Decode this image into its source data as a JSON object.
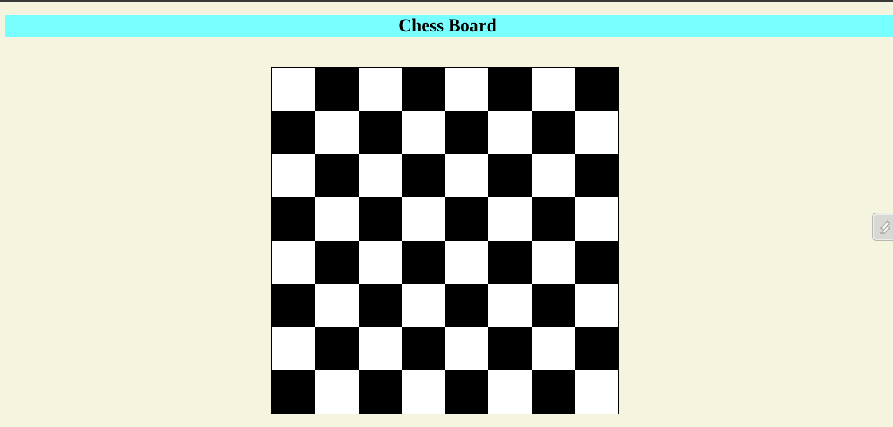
{
  "page": {
    "title": "Chess Board"
  },
  "board": {
    "rows": 8,
    "cols": 8,
    "light_color": "#ffffff",
    "dark_color": "#000000",
    "top_left": "light"
  },
  "colors": {
    "background": "#f5f4de",
    "title_bar": "#78ffff",
    "top_strip": "#3a3b38"
  },
  "side_button": {
    "icon": "edit-pen-icon"
  }
}
